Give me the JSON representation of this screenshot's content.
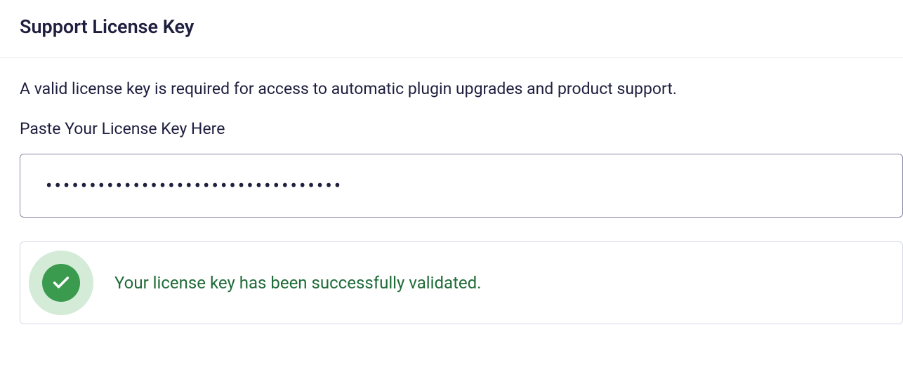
{
  "header": {
    "title": "Support License Key"
  },
  "content": {
    "description": "A valid license key is required for access to automatic plugin upgrades and product support.",
    "field_label": "Paste Your License Key Here",
    "license_value": "••••••••••••••••••••••••••••••••••"
  },
  "status": {
    "message": "Your license key has been successfully validated."
  }
}
